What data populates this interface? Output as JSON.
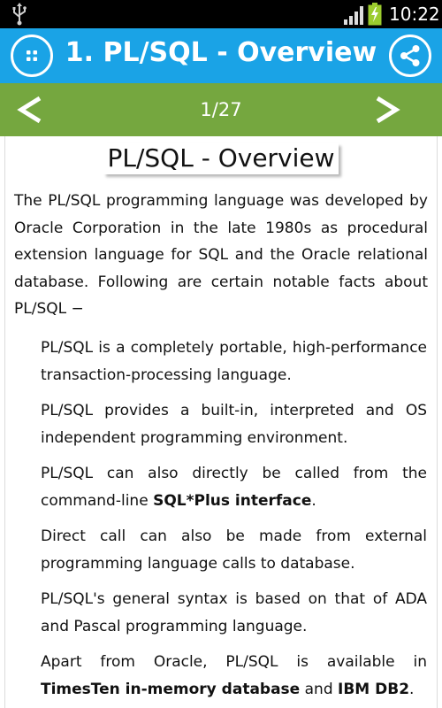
{
  "status_bar": {
    "time": "10:22",
    "icons": [
      "usb-icon",
      "signal-icon",
      "battery-charging-icon"
    ]
  },
  "header": {
    "title": "1. PL/SQL - Overview",
    "menu_icon": "grid-dots-icon",
    "share_icon": "share-icon",
    "color": "#1aa3e6"
  },
  "pager": {
    "indicator": "1/27",
    "prev_icon": "chevron-left-icon",
    "next_icon": "chevron-right-icon",
    "color": "#75a73f"
  },
  "content": {
    "title": "PL/SQL - Overview",
    "intro": "The PL/SQL programming language was developed by Oracle Corporation in the late 1980s as procedural extension language for SQL and the Oracle relational database. Following are certain notable facts about PL/SQL −",
    "facts": [
      {
        "text": "PL/SQL is a completely portable, high-performance transaction-processing language."
      },
      {
        "text": "PL/SQL provides a built-in, interpreted and OS independent programming environment."
      },
      {
        "text": "PL/SQL can also directly be called from the command-line ",
        "bold": "SQL*Plus interface",
        "after": "."
      },
      {
        "text": "Direct call can also be made from external programming language calls to database."
      },
      {
        "text": "PL/SQL's general syntax is based on that of ADA and Pascal programming language."
      },
      {
        "text": "Apart from Oracle, PL/SQL is available in ",
        "bold": "TimesTen in-memory database",
        "mid": " and ",
        "bold2": "IBM DB2",
        "after": "."
      }
    ]
  }
}
